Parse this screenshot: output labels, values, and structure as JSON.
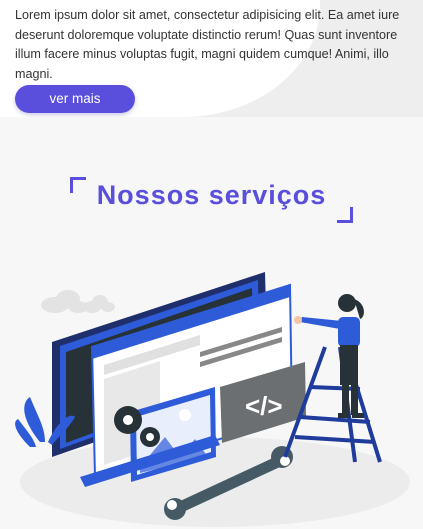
{
  "hero": {
    "text": "Lorem ipsum dolor sit amet, consectetur adipisicing elit. Ea amet iure deserunt doloremque voluptate distinctio rerum! Quas sunt inventore illum facere minus voluptas fugit, magni quidem cumque! Animi, illo magni.",
    "button_label": "ver mais"
  },
  "services": {
    "title": "Nossos serviços",
    "code_symbol": "</>"
  },
  "colors": {
    "accent": "#5a4fdc",
    "illustration_blue": "#2e5bd8",
    "dark_navy": "#1f2f6b"
  }
}
